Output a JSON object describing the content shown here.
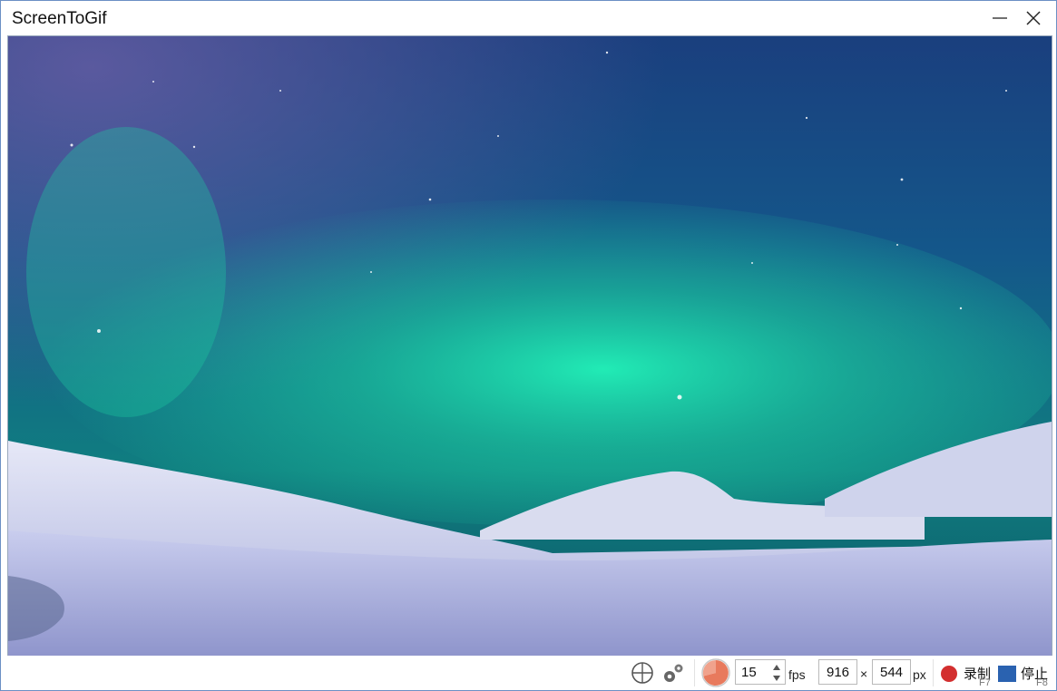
{
  "window": {
    "title": "ScreenToGif"
  },
  "titlebar_buttons": {
    "minimize_icon": "minimize-icon",
    "close_icon": "close-icon"
  },
  "capture_area": {
    "description_icon": "capture-frame"
  },
  "statusbar": {
    "snap_icon": "crosshair-icon",
    "settings_icon": "gears-icon",
    "frame_rate_icon": "frame-rate-pie-icon",
    "fps": {
      "value": "15",
      "unit": "fps"
    },
    "size": {
      "width": "916",
      "separator": "×",
      "height": "544",
      "unit": "px"
    },
    "record": {
      "label": "录制",
      "shortcut": "F7",
      "color": "#d32f2f"
    },
    "stop": {
      "label": "停止",
      "shortcut": "F8",
      "color": "#2a62b0"
    }
  },
  "colors": {
    "accent": "#2a62b0",
    "frame_border": "#6b8fc4",
    "pie": "#e87a5d"
  }
}
